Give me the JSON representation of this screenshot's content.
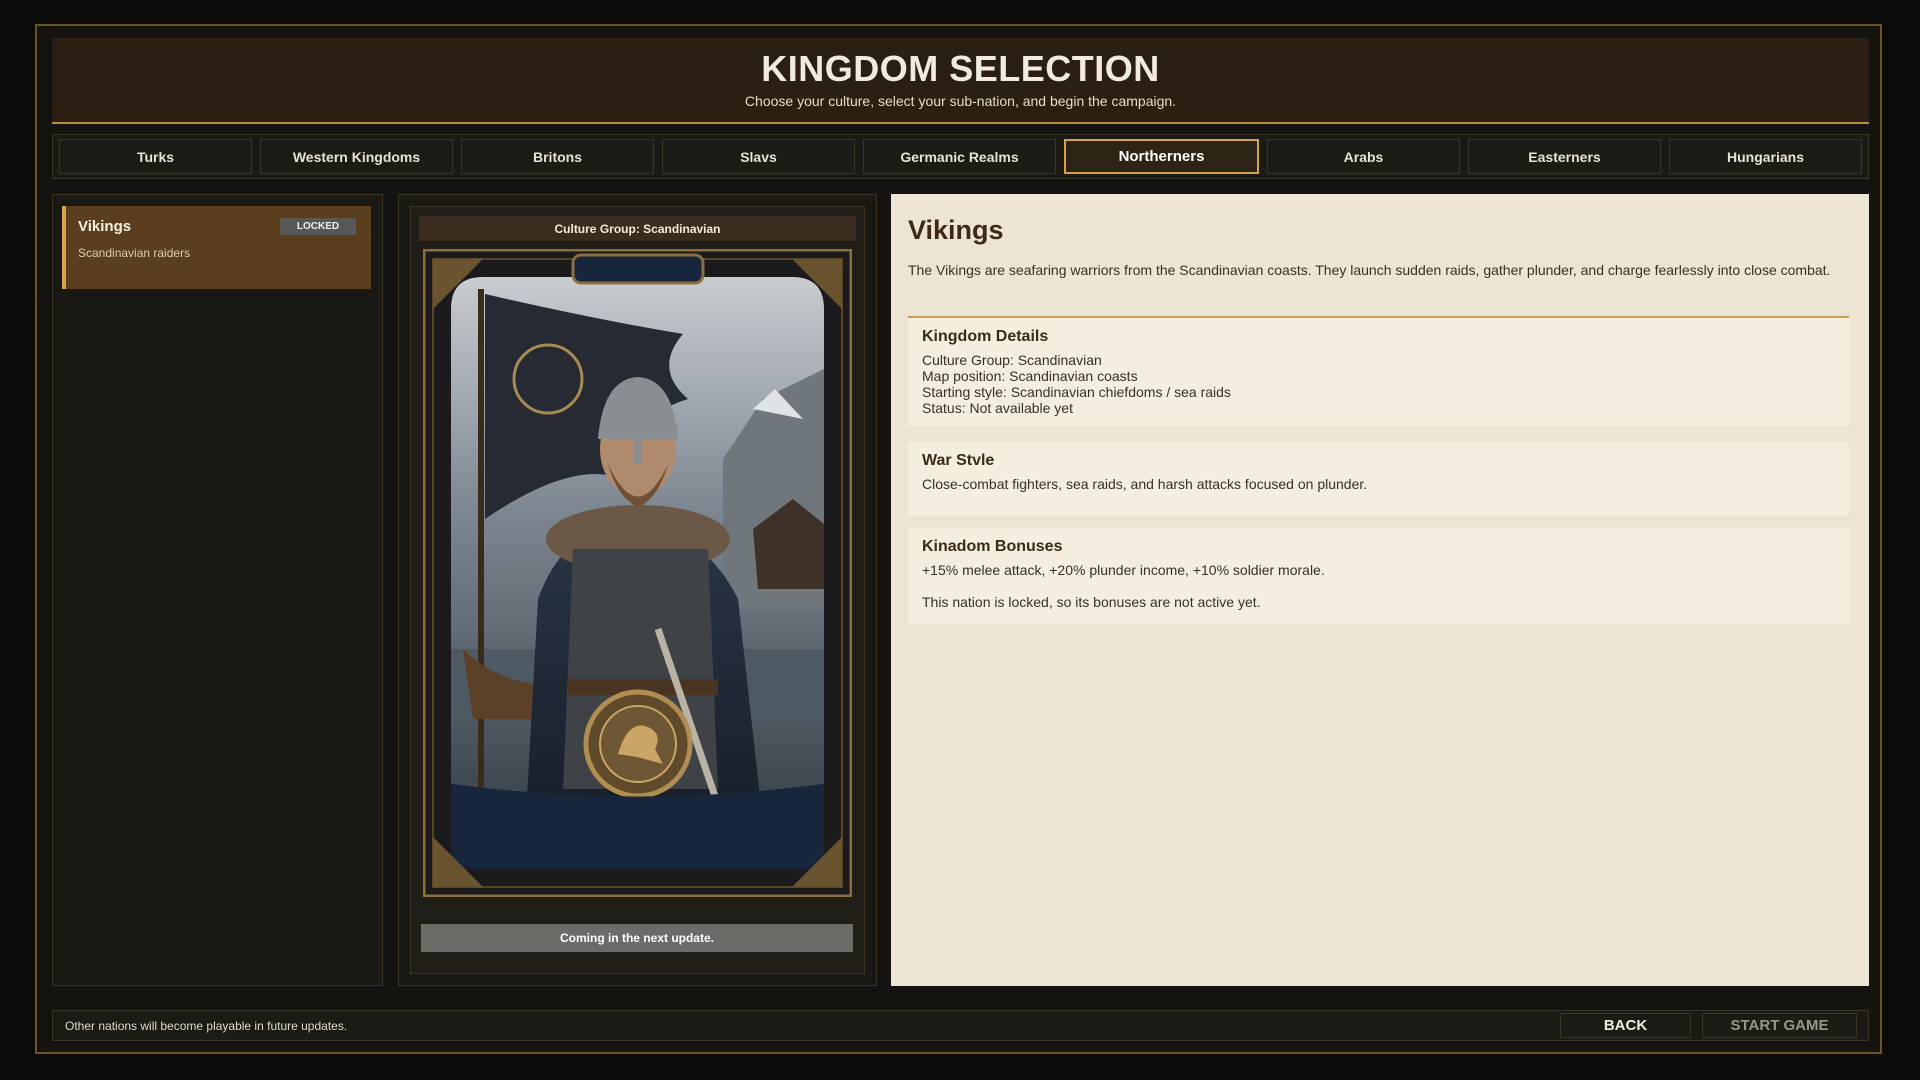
{
  "header": {
    "title": "KINGDOM SELECTION",
    "subtitle": "Choose your culture, select your sub-nation, and begin the campaign."
  },
  "tabs": [
    {
      "label": "Turks"
    },
    {
      "label": "Western Kingdoms"
    },
    {
      "label": "Britons"
    },
    {
      "label": "Slavs"
    },
    {
      "label": "Germanic Realms"
    },
    {
      "label": "Northerners",
      "active": true
    },
    {
      "label": "Arabs"
    },
    {
      "label": "Easterners"
    },
    {
      "label": "Hungarians"
    }
  ],
  "nation_list": [
    {
      "name": "Vikings",
      "description": "Scandinavian raiders",
      "badge": "LOCKED"
    }
  ],
  "preview": {
    "culture_group": "Culture Group: Scandinavian",
    "portrait_icon": "raven",
    "coming_soon": "Coming in the next update."
  },
  "details": {
    "title": "Vikings",
    "intro": "The Vikings are seafaring warriors from the Scandinavian coasts. They launch sudden raids, gather plunder, and charge fearlessly into close combat.",
    "kingdom_details": {
      "heading": "Kingdom Details",
      "lines": [
        "Culture Group: Scandinavian",
        "Map position: Scandinavian coasts",
        "Starting style: Scandinavian chiefdoms / sea raids",
        "Status: Not available yet"
      ]
    },
    "war_style": {
      "heading": "War Stvle",
      "text": "Close-combat fighters, sea raids, and harsh attacks focused on plunder."
    },
    "bonuses": {
      "heading": "Kinadom Bonuses",
      "text": "+15% melee attack, +20% plunder income, +10% soldier morale.",
      "note": "This nation is locked, so its bonuses are not active yet."
    }
  },
  "footer": {
    "note": "Other nations will become playable in future updates.",
    "back_label": "BACK",
    "start_label": "START GAME"
  },
  "colors": {
    "accent_gold": "#d2a24d",
    "header_bg": "#2b1e13",
    "panel_bg": "#ece4d4"
  }
}
